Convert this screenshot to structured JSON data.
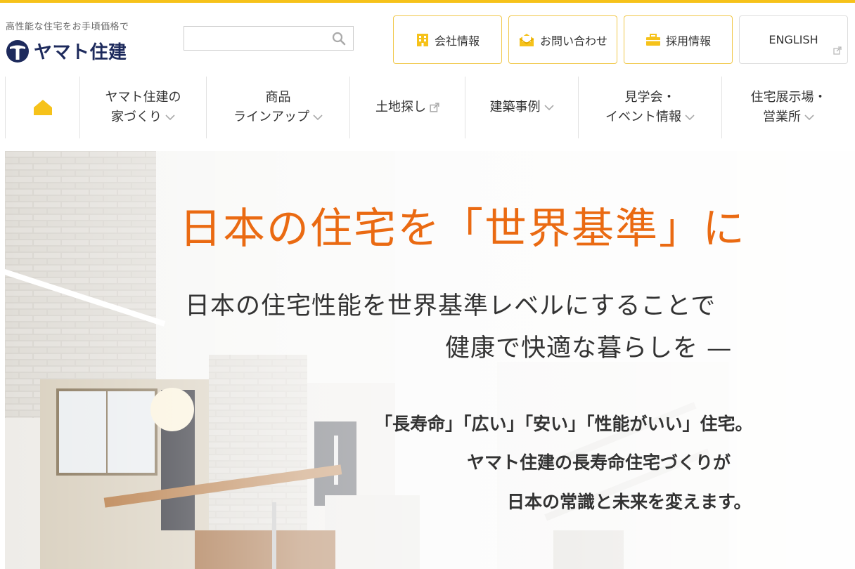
{
  "header": {
    "tagline": "高性能な住宅をお手頃価格で",
    "logo_text": "ヤマト住建",
    "search": {
      "value": "",
      "placeholder": ""
    },
    "buttons": [
      {
        "label": "会社情報",
        "icon": "building-icon"
      },
      {
        "label": "お問い合わせ",
        "icon": "mail-icon"
      },
      {
        "label": "採用情報",
        "icon": "briefcase-icon"
      },
      {
        "label": "ENGLISH",
        "icon": "external-link-icon"
      }
    ]
  },
  "nav": {
    "home_icon": "home-icon",
    "items": [
      {
        "line1": "ヤマト住建の",
        "line2": "家づくり",
        "icon": "chevron-down-icon"
      },
      {
        "line1": "商品",
        "line2": "ラインアップ",
        "icon": "chevron-down-icon"
      },
      {
        "line1": "土地探し",
        "line2": "",
        "icon": "external-link-icon"
      },
      {
        "line1": "建築事例",
        "line2": "",
        "icon": "chevron-down-icon"
      },
      {
        "line1": "見学会・",
        "line2": "イベント情報",
        "icon": "chevron-down-icon"
      },
      {
        "line1": "住宅展示場・",
        "line2": "営業所",
        "icon": "chevron-down-icon"
      }
    ]
  },
  "hero": {
    "title": "日本の住宅を「世界基準」に",
    "sub1": "日本の住宅性能を世界基準レベルにすることで",
    "sub2": "健康で快適な暮らしを —",
    "p1": "「長寿命」「広い」「安い」「性能がいい」住宅。",
    "p2": "ヤマト住建の長寿命住宅づくりが",
    "p3": "日本の常識と未来を変えます。"
  },
  "colors": {
    "accent": "#f6c21a",
    "title_orange": "#ea6a12",
    "logo_navy": "#1d2a5c",
    "text": "#333333"
  }
}
